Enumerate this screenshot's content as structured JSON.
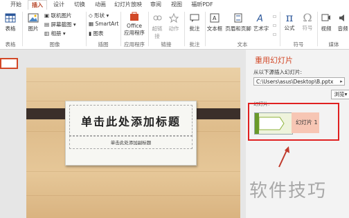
{
  "tabs": [
    "开始",
    "插入",
    "设计",
    "切换",
    "动画",
    "幻灯片放映",
    "审阅",
    "视图",
    "福昕PDF"
  ],
  "ribbon": {
    "table": "表格",
    "picture": "图片",
    "online_picture": "联机图片",
    "screenshot": "屏幕截图",
    "album": "相册",
    "shapes": "形状",
    "smartart": "SmartArt",
    "chart": "图表",
    "office_line1": "Office",
    "office_line2": "应用程序",
    "hyperlink": "超链接",
    "action": "动作",
    "comment": "批注",
    "textbox": "文本框",
    "header_footer": "页眉和页脚",
    "wordart": "艺术字",
    "formula": "公式",
    "symbol": "符号",
    "video": "视频",
    "audio": "音频",
    "groups": {
      "tables": "表格",
      "images": "图像",
      "illustrations": "插图",
      "apps": "应用程序",
      "links": "链接",
      "comments": "批注",
      "text": "文本",
      "symbols": "符号",
      "media": "媒体"
    }
  },
  "slide": {
    "title_placeholder": "单击此处添加标题",
    "subtitle_placeholder": "单击此处添加副标题"
  },
  "pane": {
    "title": "重用幻灯片",
    "insert_from_label": "从以下源插入幻灯片:",
    "path_value": "C:\\Users\\asus\\Desktop\\B.pptx",
    "browse_label": "浏览",
    "slides_label": "幻灯片:",
    "slide_item_label": "幻灯片 1"
  },
  "watermark": "软件技巧",
  "colors": {
    "accent": "#d24726",
    "highlight_frame": "#e02020"
  }
}
